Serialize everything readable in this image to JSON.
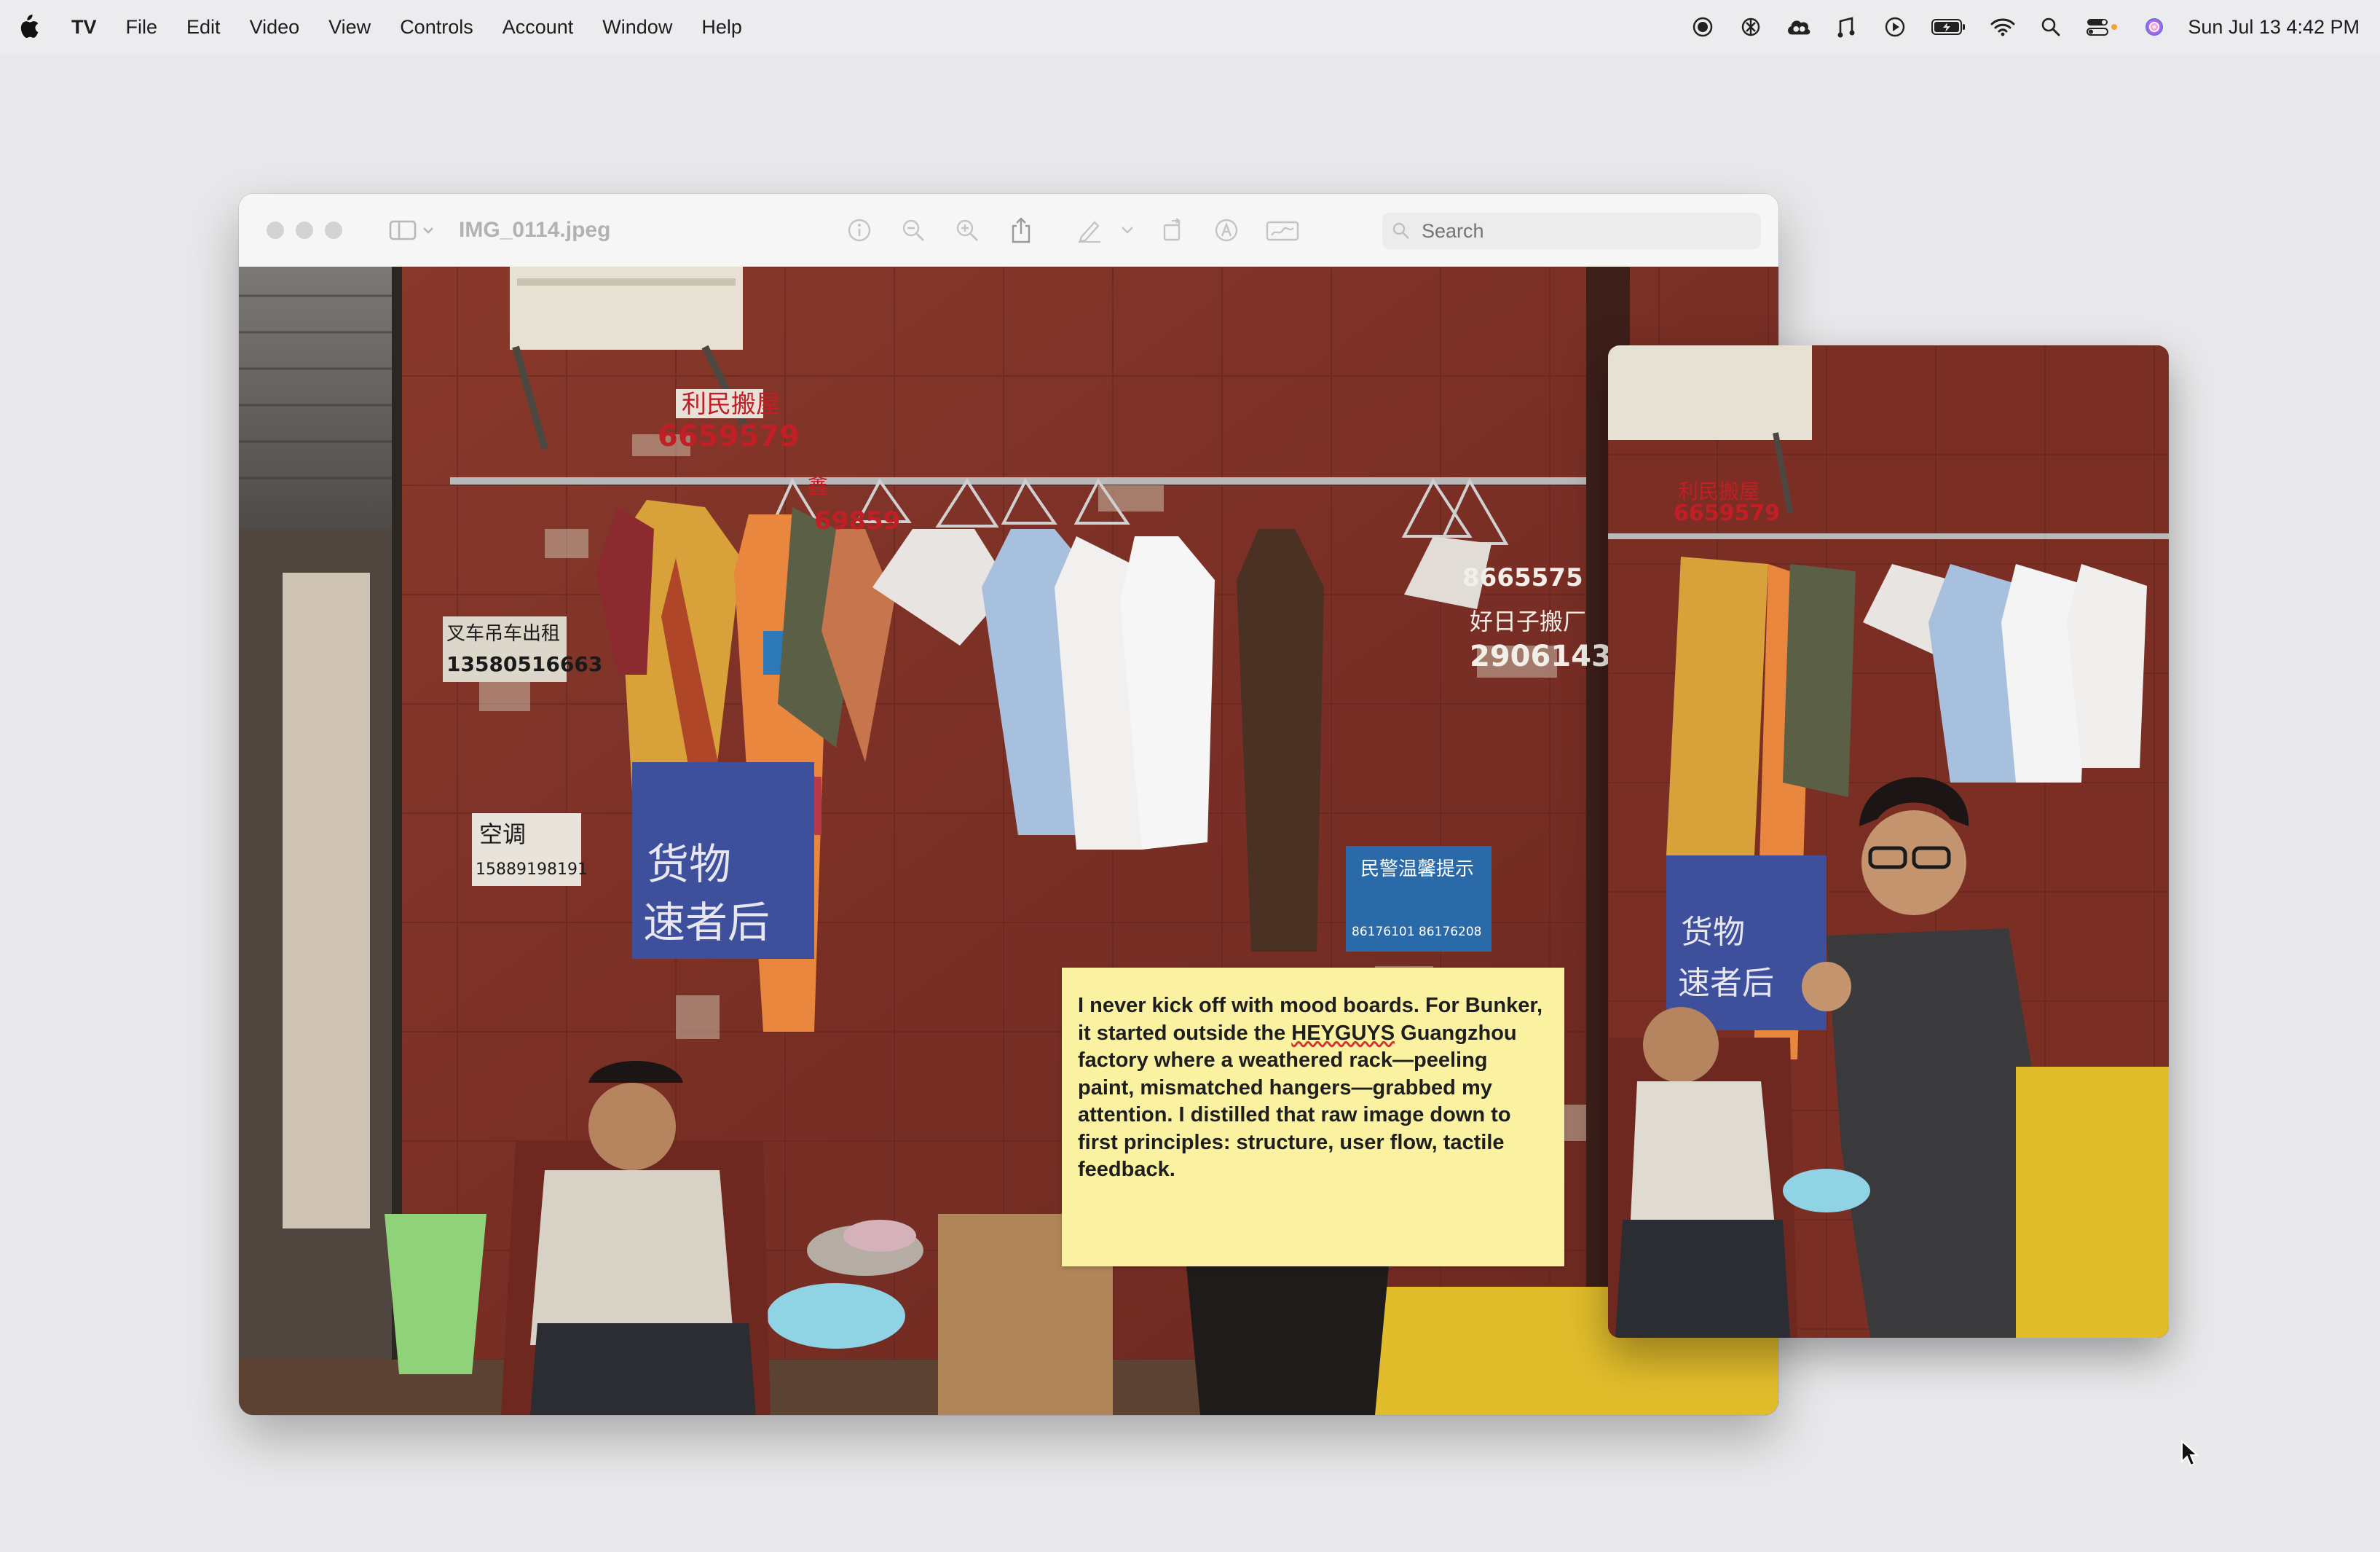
{
  "menubar": {
    "app_name": "TV",
    "items": [
      "File",
      "Edit",
      "Video",
      "View",
      "Controls",
      "Account",
      "Window",
      "Help"
    ],
    "clock": "Sun Jul 13  4:42 PM",
    "status_icons": [
      "screen-record-icon",
      "chatgpt-icon",
      "creative-cloud-icon",
      "music-recognition-icon",
      "play-icon",
      "battery-icon",
      "wifi-icon",
      "spotlight-search-icon",
      "control-center-icon",
      "siri-icon"
    ]
  },
  "preview_window": {
    "title": "IMG_0114.jpeg",
    "search_placeholder": "Search",
    "toolbar_icons": [
      "info-icon",
      "zoom-out-icon",
      "zoom-in-icon",
      "share-icon",
      "markup-pen-icon",
      "rotate-icon",
      "annotate-icon",
      "signature-icon"
    ]
  },
  "photo_signs": {
    "sign_top_name": "利民搬屋",
    "sign_top_phone": "6659579",
    "sign_mid_name": "鑫",
    "sign_mid_phone": "69859",
    "sign_taxi": "叉车吊车出租",
    "sign_taxi_phone": "13580516663",
    "sign_right_phone": "8665575",
    "sign_haorizi": "好日子搬厂",
    "sign_haorizi_phone": "29061432",
    "sign_kongtiao": "空调",
    "sign_kongtiao_phone": "15889198191",
    "sign_blue_title": "民警温馨提示",
    "sign_blue_phone": "86176101 86176208",
    "banner_text_1": "货物",
    "banner_text_2": "速者后"
  },
  "note": {
    "line_1": "I never kick off with mood boards. For Bunker,",
    "line_2_pre": "it started outside the ",
    "line_2_brand": "HEYGUYS",
    "line_2_post": " Guangzhou",
    "line_3": "factory where a weathered rack—peeling",
    "line_4": "paint, mismatched hangers—grabbed my",
    "line_5": "attention. I distilled that raw image down to",
    "line_6": "first principles: structure, user flow, tactile",
    "line_7": "feedback."
  },
  "colors": {
    "wall": "#7a2e24",
    "note": "#fbf2a1",
    "banner": "#3e4f9c"
  }
}
